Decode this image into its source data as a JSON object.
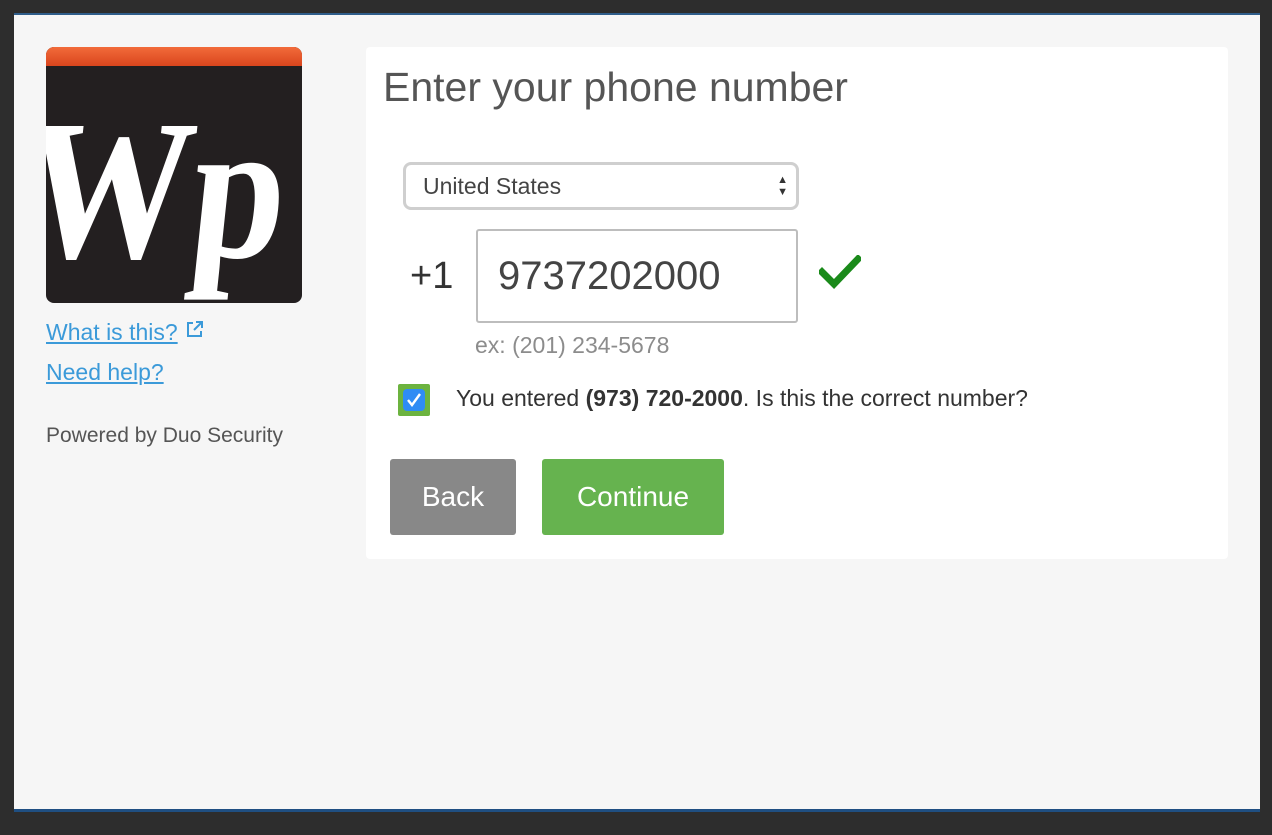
{
  "sidebar": {
    "logo_text": "Wp",
    "links": [
      {
        "label": "What is this?",
        "icon": "external-link-icon"
      },
      {
        "label": "Need help?"
      }
    ],
    "powered_by": "Powered by Duo Security"
  },
  "main": {
    "title": "Enter your phone number",
    "country": {
      "selected": "United States"
    },
    "phone": {
      "prefix": "+1",
      "value": "9737202000",
      "example": "ex: (201) 234-5678",
      "status_icon": "checkmark-icon"
    },
    "confirm": {
      "checked": true,
      "text_before": "You entered ",
      "number": "(973) 720-2000",
      "text_after": ". Is this the correct number?"
    },
    "buttons": {
      "back": "Back",
      "continue": "Continue"
    }
  },
  "colors": {
    "link": "#3b9ad9",
    "continue": "#66b34f",
    "back": "#888888",
    "valid_check": "#1a8a1a",
    "logo_bar": "#e8572a"
  }
}
